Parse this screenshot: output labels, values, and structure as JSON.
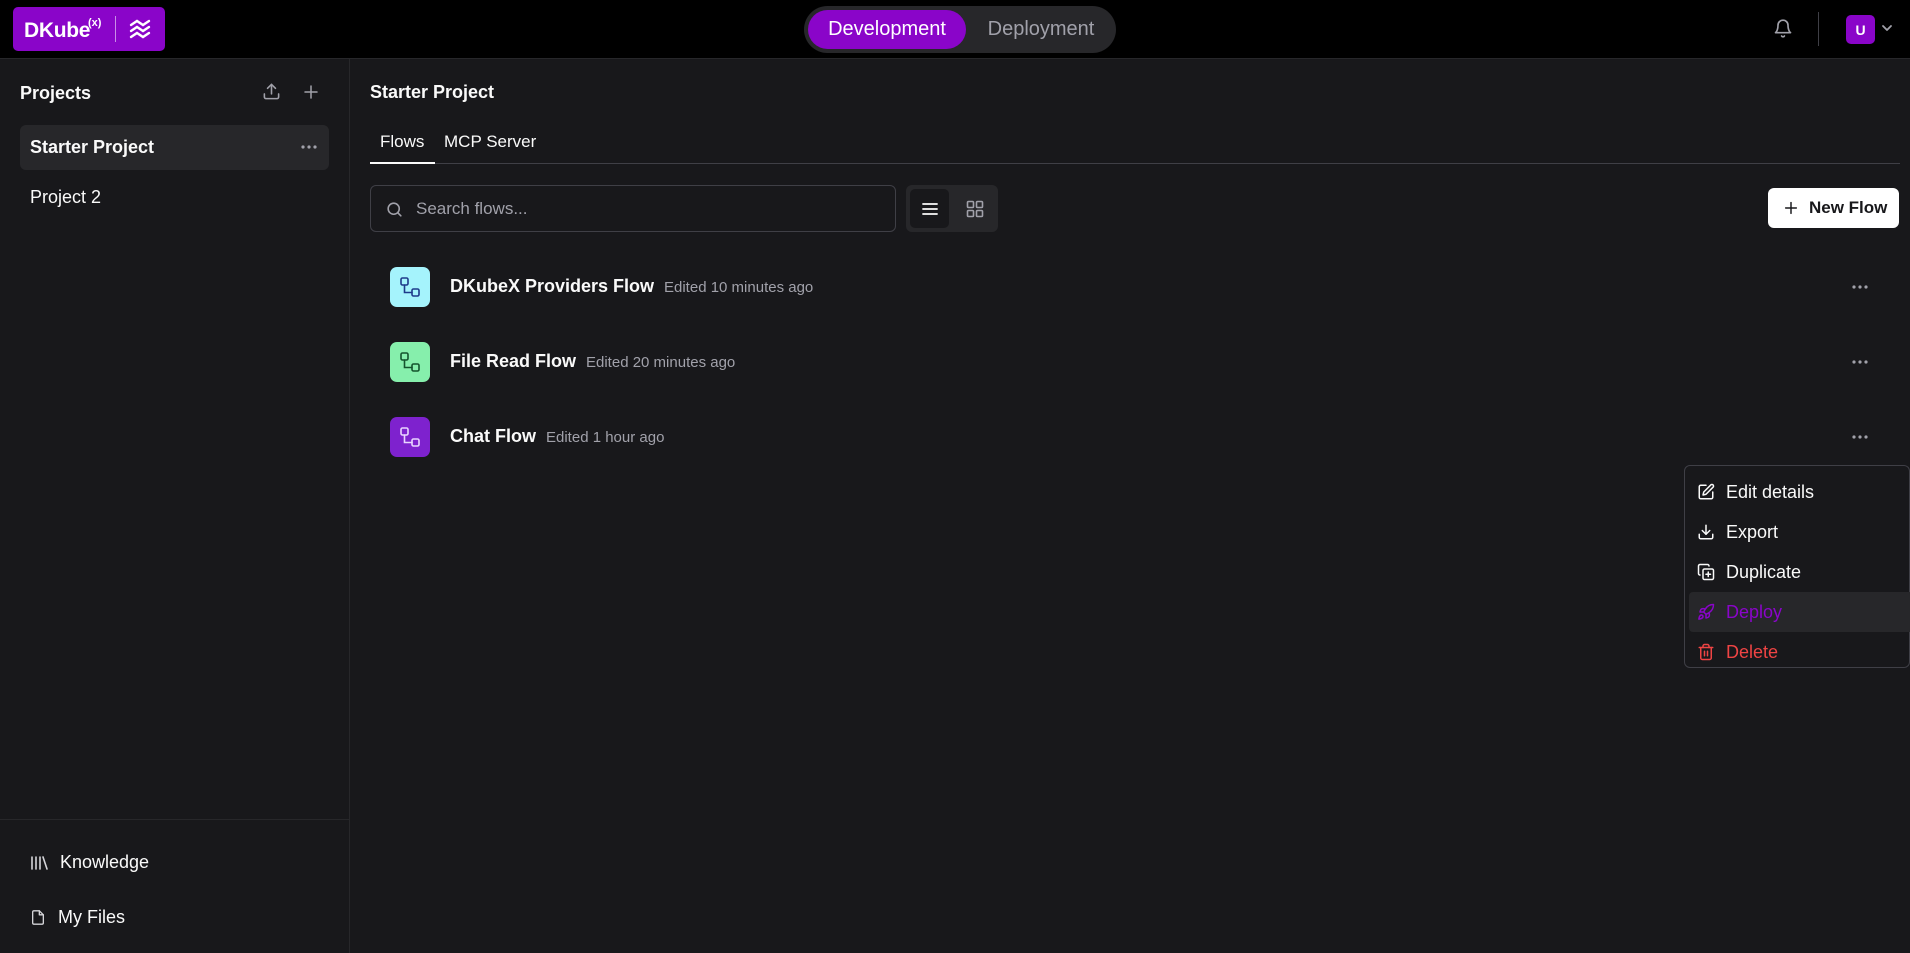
{
  "brand": {
    "name": "DKube",
    "superscript": "(x)",
    "color": "#8a05c9"
  },
  "mode_switch": {
    "active": "Development",
    "inactive": "Deployment"
  },
  "user": {
    "initial": "U"
  },
  "sidebar": {
    "title": "Projects",
    "projects": [
      {
        "label": "Starter Project",
        "selected": true
      },
      {
        "label": "Project 2",
        "selected": false
      }
    ],
    "footer_links": [
      {
        "label": "Knowledge",
        "icon": "library-icon"
      },
      {
        "label": "My Files",
        "icon": "file-icon"
      }
    ]
  },
  "main": {
    "breadcrumb": "Starter Project",
    "tabs": [
      {
        "label": "Flows",
        "active": true
      },
      {
        "label": "MCP Server",
        "active": false
      }
    ],
    "search": {
      "placeholder": "Search flows...",
      "value": ""
    },
    "new_flow_label": "New Flow",
    "flows": [
      {
        "name": "DKubeX Providers Flow",
        "edited": "Edited 10 minutes ago",
        "icon_color": "#a5f3fc"
      },
      {
        "name": "File Read Flow",
        "edited": "Edited 20 minutes ago",
        "icon_color": "#86efac"
      },
      {
        "name": "Chat Flow",
        "edited": "Edited 1 hour ago",
        "icon_color": "#7e22ce"
      }
    ]
  },
  "context_menu": {
    "items": [
      {
        "label": "Edit details",
        "icon": "edit-icon"
      },
      {
        "label": "Export",
        "icon": "download-icon"
      },
      {
        "label": "Duplicate",
        "icon": "duplicate-icon"
      },
      {
        "label": "Deploy",
        "icon": "rocket-icon",
        "highlighted": true
      },
      {
        "label": "Delete",
        "icon": "trash-icon",
        "destructive": true
      }
    ]
  }
}
